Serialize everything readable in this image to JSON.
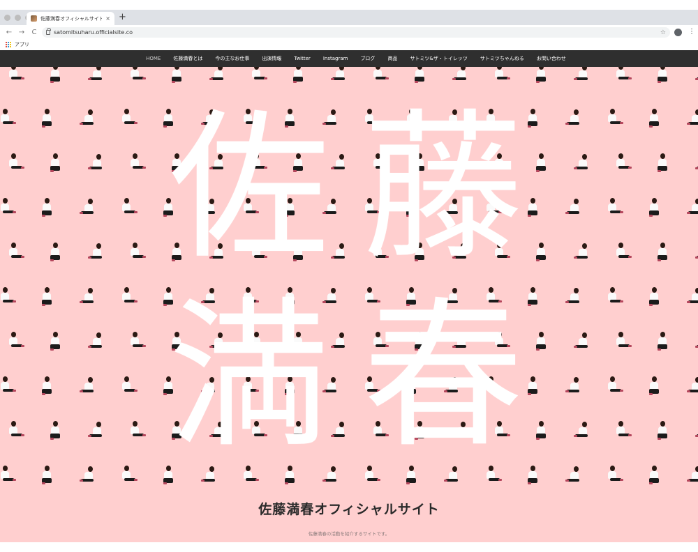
{
  "browser": {
    "tab_title": "佐藤満春オフィシャルサイト",
    "tab_close": "×",
    "new_tab": "+",
    "url": "satomitsuharu.officialsite.co",
    "back": "←",
    "forward": "→",
    "reload": "C",
    "star": "☆",
    "menu": "⋮",
    "bookmark_apps": "アプリ"
  },
  "nav": {
    "items": [
      {
        "label": "HOME"
      },
      {
        "label": "佐藤満春とは"
      },
      {
        "label": "今の主なお仕事"
      },
      {
        "label": "出演情報"
      },
      {
        "label": "Twitter"
      },
      {
        "label": "Instagram"
      },
      {
        "label": "ブログ"
      },
      {
        "label": "商品"
      },
      {
        "label": "サトミツ&ザ・トイレッツ"
      },
      {
        "label": "サトミツちゃんねる"
      },
      {
        "label": "お問い合わせ"
      }
    ]
  },
  "hero": {
    "kanji": [
      "佐",
      "藤",
      "満",
      "春"
    ],
    "background_color": "#ffcfcf"
  },
  "site": {
    "title": "佐藤満春オフィシャルサイト",
    "description": "佐藤満春の活動を紹介するサイトです。"
  }
}
